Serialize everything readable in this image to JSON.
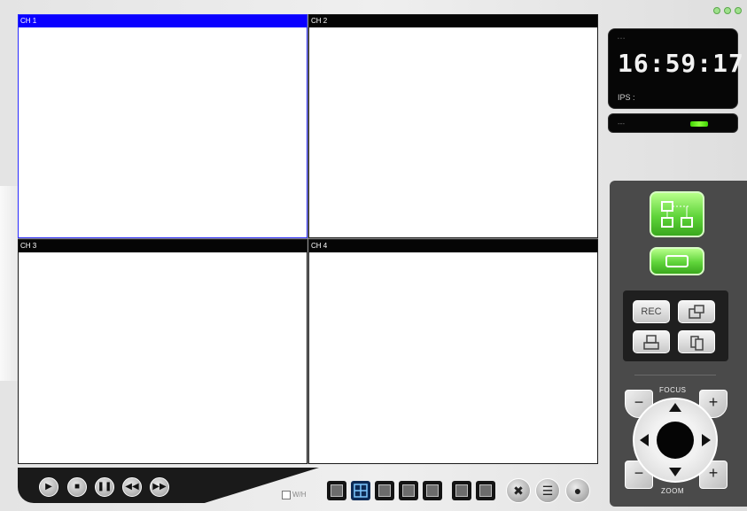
{
  "channels": [
    {
      "label": "CH 1",
      "selected": true
    },
    {
      "label": "CH 2",
      "selected": false
    },
    {
      "label": "CH 3",
      "selected": false
    },
    {
      "label": "CH 4",
      "selected": false
    }
  ],
  "clock": {
    "time": "16:59:17",
    "ips_label": "IPS :"
  },
  "status": {
    "text": "---"
  },
  "controls": {
    "rec_label": "REC",
    "focus_label": "FOCUS",
    "zoom_label": "ZOOM",
    "minus": "−",
    "plus": "+"
  },
  "wh_label": "W/H",
  "colors": {
    "selected_channel": "#0a00ff",
    "accent_green": "#5fd43a",
    "panel": "#4a4a4a"
  }
}
